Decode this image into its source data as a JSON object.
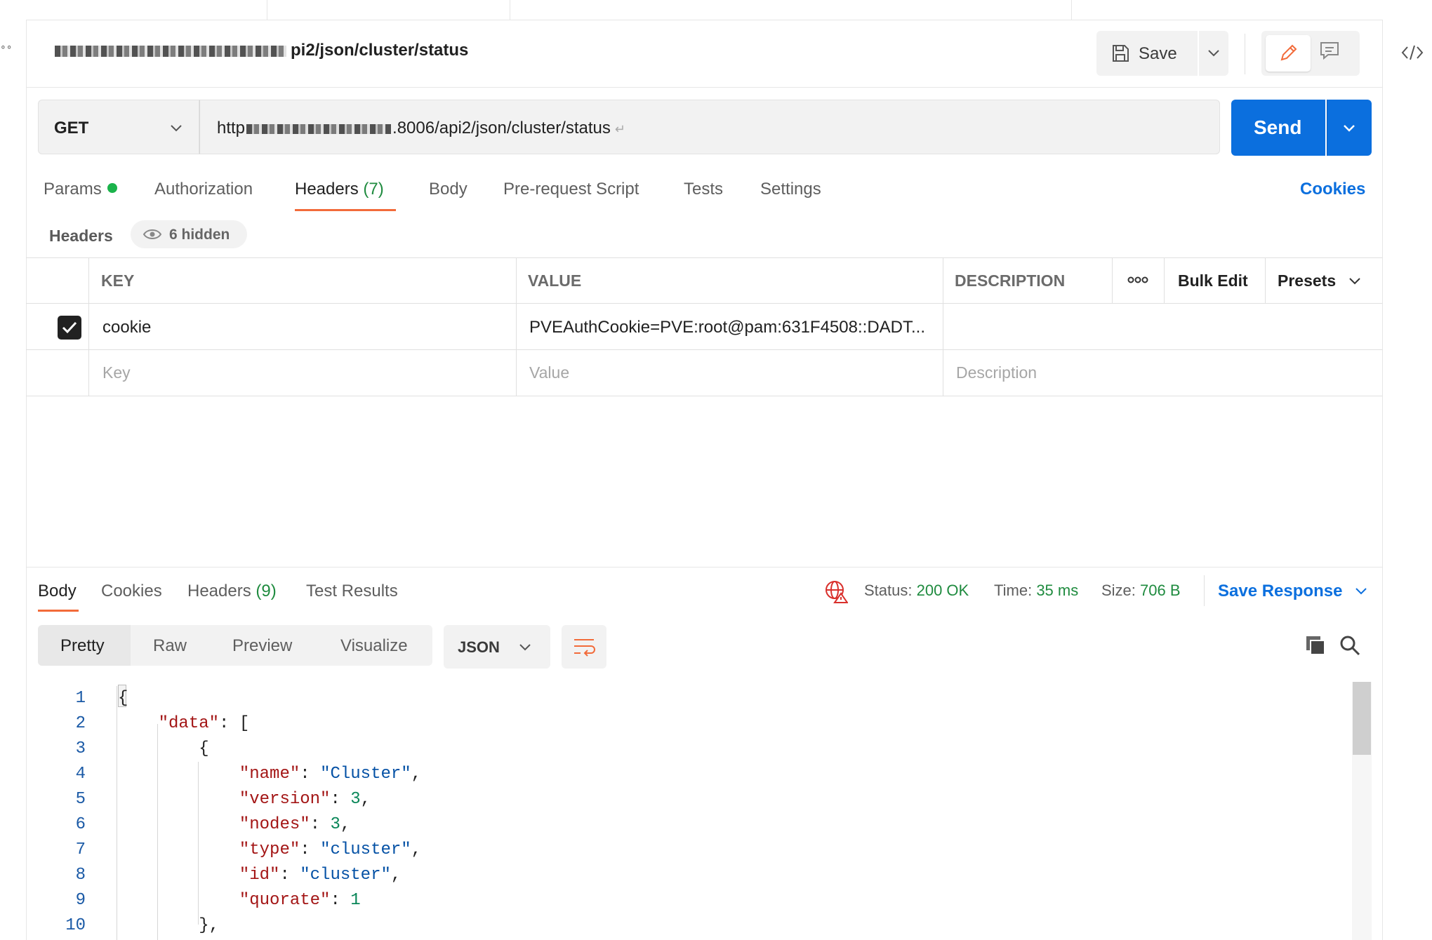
{
  "request": {
    "title_suffix": "pi2/json/cluster/status",
    "save_label": "Save",
    "method": "GET",
    "url_prefix": "http",
    "url_suffix": ".8006/api2/json/cluster/status",
    "send_label": "Send"
  },
  "request_tabs": {
    "params": "Params",
    "authorization": "Authorization",
    "headers": "Headers",
    "headers_count": "(7)",
    "body": "Body",
    "pre_request_script": "Pre-request Script",
    "tests": "Tests",
    "settings": "Settings",
    "cookies": "Cookies"
  },
  "headers_section": {
    "title": "Headers",
    "hidden_label": "6 hidden",
    "columns": {
      "key": "KEY",
      "value": "VALUE",
      "description": "DESCRIPTION",
      "bulk_edit": "Bulk Edit",
      "presets": "Presets"
    },
    "rows": [
      {
        "enabled": true,
        "key": "cookie",
        "value": "PVEAuthCookie=PVE:root@pam:631F4508::DADT..."
      }
    ],
    "placeholders": {
      "key": "Key",
      "value": "Value",
      "description": "Description"
    }
  },
  "response": {
    "tabs": {
      "body": "Body",
      "cookies": "Cookies",
      "headers": "Headers",
      "headers_count": "(9)",
      "test_results": "Test Results"
    },
    "status_label": "Status:",
    "status_value": "200 OK",
    "time_label": "Time:",
    "time_value": "35 ms",
    "size_label": "Size:",
    "size_value": "706 B",
    "save_response": "Save Response",
    "views": {
      "pretty": "Pretty",
      "raw": "Raw",
      "preview": "Preview",
      "visualize": "Visualize"
    },
    "format": "JSON",
    "line_numbers": [
      "1",
      "2",
      "3",
      "4",
      "5",
      "6",
      "7",
      "8",
      "9",
      "10"
    ]
  },
  "colors": {
    "accent_blue": "#0b6fde",
    "tab_underline": "#f26b3a",
    "status_green": "#1f8b3f",
    "json_key": "#a31515",
    "json_string": "#0451a5",
    "json_number": "#098658"
  }
}
